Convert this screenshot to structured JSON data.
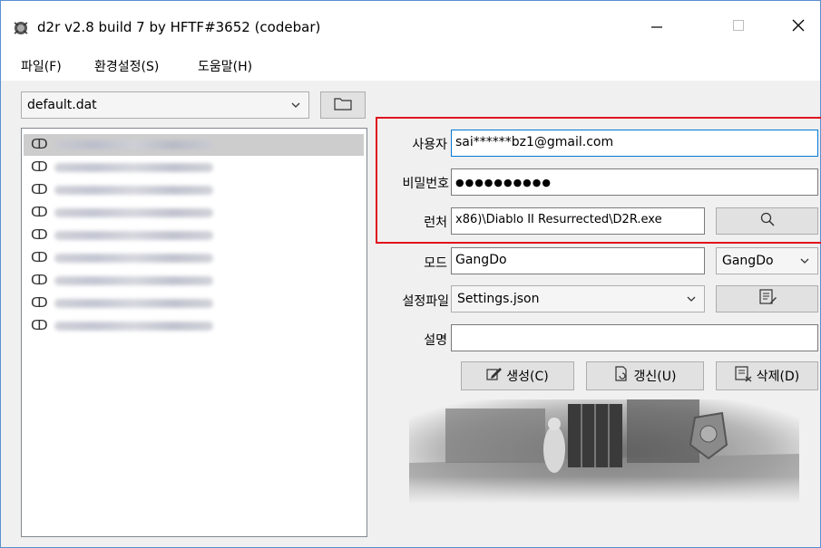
{
  "window": {
    "title": "d2r v2.8 build 7 by HFTF#3652 (codebar)",
    "icons": [
      "app-icon",
      "minimize-icon",
      "maximize-icon",
      "close-icon"
    ]
  },
  "menu": {
    "items": [
      "파일(F)",
      "환경설정(S)",
      "도움말(H)"
    ]
  },
  "profile": {
    "selected": "default.dat"
  },
  "accounts": {
    "count": 10,
    "selected_index": 0
  },
  "form": {
    "user_label": "사용자",
    "user_value": "sai******bz1@gmail.com",
    "password_label": "비밀번호",
    "password_value": "●●●●●●●●●●",
    "launcher_label": "런처",
    "launcher_value": "x86)\\Diablo II Resurrected\\D2R.exe",
    "mode_label": "모드",
    "mode_value": "GangDo",
    "mode_select": "GangDo",
    "settings_label": "설정파일",
    "settings_value": "Settings.json",
    "desc_label": "설명",
    "desc_value": ""
  },
  "buttons": {
    "create": "생성(C)",
    "update": "갱신(U)",
    "delete": "삭제(D)"
  },
  "colors": {
    "highlight_box": "#e0141e",
    "window_bg": "#f0f0f0"
  }
}
